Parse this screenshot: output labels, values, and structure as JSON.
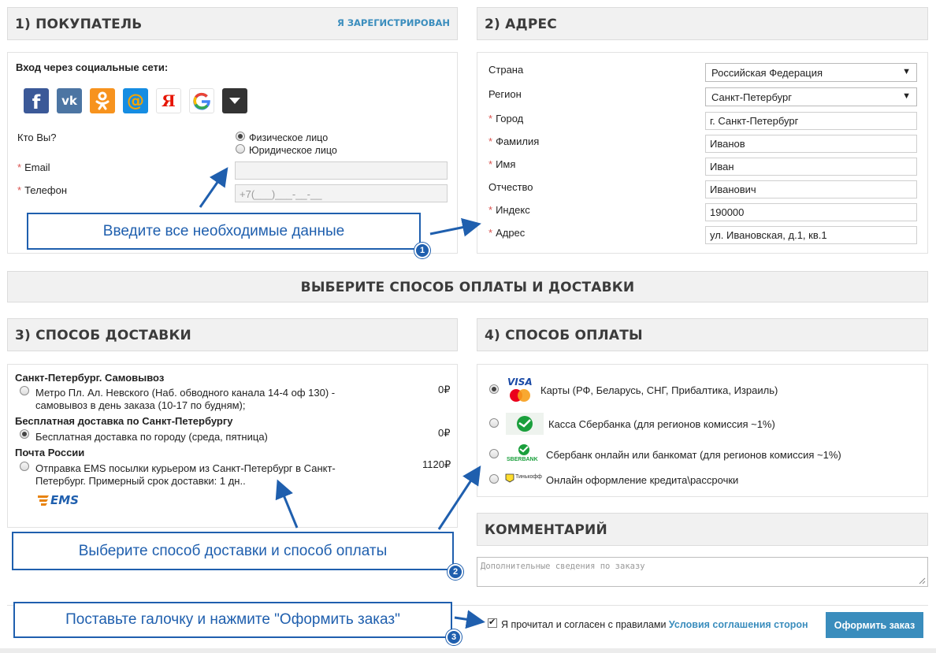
{
  "buyer": {
    "title": "1)  ПОКУПАТЕЛЬ",
    "registered_link": "Я ЗАРЕГИСТРИРОВАН",
    "social_login_label": "Вход через социальные сети:",
    "social_icons": [
      "facebook-icon",
      "vk-icon",
      "odnoklassniki-icon",
      "mail-ru-icon",
      "yandex-icon",
      "google-icon",
      "more-dropdown-icon"
    ],
    "who_label": "Кто Вы?",
    "person_options": [
      "Физическое лицо",
      "Юридическое лицо"
    ],
    "selected_person": "Физическое лицо",
    "email_label": "Email",
    "email_value": "",
    "phone_label": "Телефон",
    "phone_placeholder": "+7(___)___-__-__"
  },
  "address": {
    "title": "2)  АДРЕС",
    "country_label": "Страна",
    "country_value": "Российская Федерация",
    "region_label": "Регион",
    "region_value": "Санкт-Петербург",
    "city_label": "Город",
    "city_value": "г. Санкт-Петербург",
    "lastname_label": "Фамилия",
    "lastname_value": "Иванов",
    "firstname_label": "Имя",
    "firstname_value": "Иван",
    "patronymic_label": "Отчество",
    "patronymic_value": "Иванович",
    "zip_label": "Индекс",
    "zip_value": "190000",
    "street_label": "Адрес",
    "street_value": "ул. Ивановская, д.1, кв.1"
  },
  "banner": {
    "title": "ВЫБЕРИТЕ СПОСОБ ОПЛАТЫ И ДОСТАВКИ"
  },
  "delivery": {
    "title": "3)  СПОСОБ ДОСТАВКИ",
    "groups": [
      {
        "heading": "Санкт-Петербург. Самовывоз",
        "line1": "Метро Пл. Ал. Невского (Наб. обводного канала 14-4 оф 130) -",
        "line2": "самовывоз в день заказа (10-17 по будням);",
        "price": "0₽",
        "selected": false
      },
      {
        "heading": "Бесплатная доставка по Санкт-Петербургу",
        "line1": "Бесплатная доставка по городу (среда, пятница)",
        "line2": "",
        "price": "0₽",
        "selected": true
      },
      {
        "heading": "Почта России",
        "line1": "Отправка EMS посылки курьером из Санкт-Петербург в Санкт-",
        "line2": "Петербург. Примерный срок доставки: 1 дн..",
        "price": "1120₽",
        "selected": false
      }
    ],
    "ems_logo_text": "EMS"
  },
  "payment": {
    "title": "4)  СПОСОБ ОПЛАТЫ",
    "options": [
      {
        "label": "Карты (РФ, Беларусь, СНГ, Прибалтика, Израиль)",
        "icon": "visa-mastercard-icon",
        "selected": true
      },
      {
        "label": "Касса Сбербанка (для регионов комиссия ~1%)",
        "icon": "sberbank-icon",
        "selected": false
      },
      {
        "label": "Сбербанк онлайн или банкомат (для регионов комиссия ~1%)",
        "icon": "sberbank-online-icon",
        "selected": false
      },
      {
        "label": "Онлайн оформление кредита\\рассрочки",
        "icon": "tinkoff-icon",
        "selected": false
      }
    ],
    "visa_text": "VISA",
    "sber_text": "SBERBANK",
    "tinkoff_text": "Тинькофф"
  },
  "comment": {
    "title": "КОММЕНТАРИЙ",
    "placeholder": "Дополнительные сведения по заказу"
  },
  "agreement": {
    "text": "Я прочитал и согласен с правилами ",
    "link": "Условия соглашения сторон",
    "checked": true
  },
  "submit_label": "Оформить заказ",
  "callouts": {
    "c1": "Введите все необходимые данные",
    "c2": "Выберите способ доставки и способ оплаты",
    "c3": "Поставьте галочку и нажмите \"Оформить заказ\"",
    "n1": "1",
    "n2": "2",
    "n3": "3"
  },
  "colors": {
    "accent": "#3a8dbd",
    "callout": "#1f5fae",
    "required": "#d9534f"
  }
}
